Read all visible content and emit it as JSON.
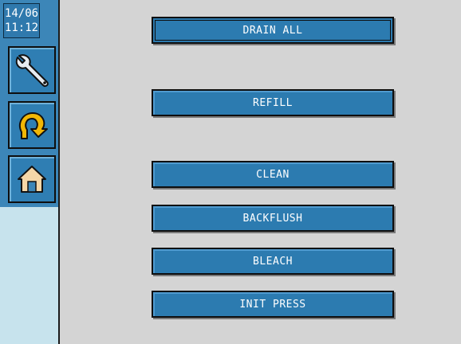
{
  "colors": {
    "panel_bg": "#d4d4d4",
    "sidebar_bg": "#c7e3ed",
    "button_blue": "#2c7bb0",
    "button_text": "#ffffff"
  },
  "clock": {
    "date": "14/06",
    "time": "11:12"
  },
  "sidebar": {
    "items": [
      {
        "icon": "wrench-icon"
      },
      {
        "icon": "return-arrow-icon"
      },
      {
        "icon": "home-icon"
      }
    ]
  },
  "actions": {
    "drain_all": "DRAIN ALL",
    "refill": "REFILL",
    "clean": "CLEAN",
    "backflush": "BACKFLUSH",
    "bleach": "BLEACH",
    "init_press": "INIT PRESS"
  }
}
